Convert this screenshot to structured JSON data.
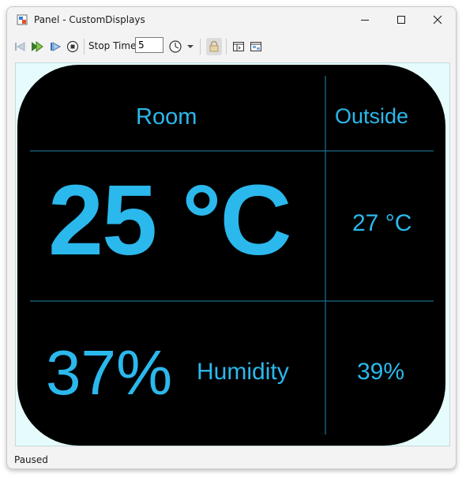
{
  "window": {
    "title": "Panel - CustomDisplays"
  },
  "toolbar": {
    "stop_time_label": "Stop Time",
    "stop_time_value": "5"
  },
  "display": {
    "headers": {
      "room": "Room",
      "outside": "Outside"
    },
    "room_temperature": "25 °C",
    "outside_temperature": "27 °C",
    "room_humidity": "37%",
    "humidity_label": "Humidity",
    "outside_humidity": "39%",
    "colors": {
      "background": "#000000",
      "text": "#2bb8ec",
      "grid": "#1a6d8a",
      "panel_background": "#e6fbfb"
    }
  },
  "status": {
    "text": "Paused"
  }
}
